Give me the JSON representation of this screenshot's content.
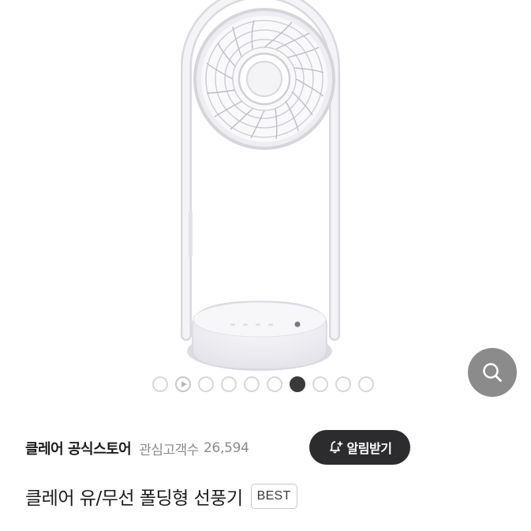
{
  "product_image": {
    "alt_subject": "white folding fan",
    "carousel": {
      "total": 10,
      "active_index": 6,
      "video_index": 1
    }
  },
  "search_button": {
    "icon": "search-icon",
    "color": "#8b8b8b"
  },
  "store": {
    "name": "클레어 공식스토어",
    "follower_label": "관심고객수",
    "follower_count": "26,594",
    "alarm_button_label": "알림받기",
    "alarm_icon": "bell-plus-icon"
  },
  "product": {
    "title": "클레어 유/무선 폴딩형 선풍기",
    "badge": "BEST"
  }
}
